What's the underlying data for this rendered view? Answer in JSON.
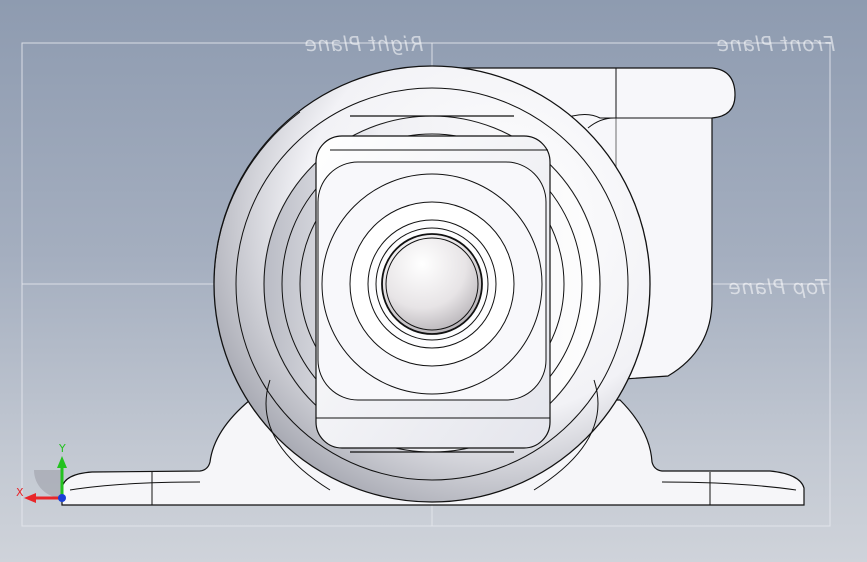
{
  "viewport": {
    "planes": {
      "right_plane": "Right Plane",
      "front_plane": "Front Plane",
      "top_plane": "Top Plane"
    },
    "triad": {
      "x_label": "X",
      "y_label": "Y",
      "x_color": "#e8262a",
      "y_color": "#23c21f",
      "z_color": "#1a3fd6"
    }
  },
  "colors": {
    "background_top": "#8e9bb0",
    "background_bottom": "#cfd3da",
    "model_fill": "#f4f4f8",
    "edge": "#111111",
    "plane_line": "#e6e8ee"
  }
}
